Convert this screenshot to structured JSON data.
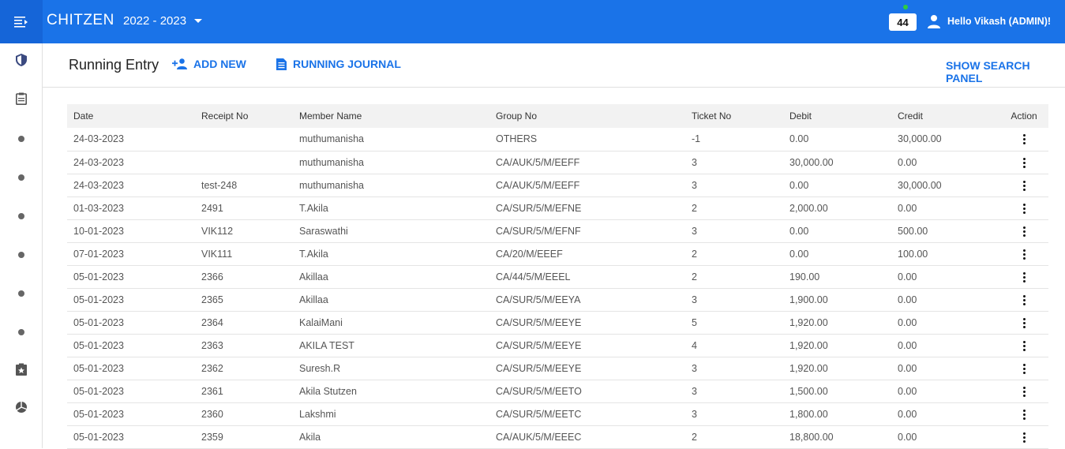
{
  "app": {
    "brand": "CHITZEN",
    "year": "2022 - 2023",
    "notification_count": "44",
    "greeting": "Hello Vikash (ADMIN)!"
  },
  "header": {
    "title": "Running Entry",
    "add_new": "ADD NEW",
    "running_journal": "RUNNING JOURNAL",
    "show_search": "SHOW SEARCH PANEL"
  },
  "columns": [
    "Date",
    "Receipt No",
    "Member Name",
    "Group No",
    "Ticket No",
    "Debit",
    "Credit",
    "Action"
  ],
  "rows": [
    [
      "24-03-2023",
      "",
      "muthumanisha",
      "OTHERS",
      "-1",
      "0.00",
      "30,000.00"
    ],
    [
      "24-03-2023",
      "",
      "muthumanisha",
      "CA/AUK/5/M/EEFF",
      "3",
      "30,000.00",
      "0.00"
    ],
    [
      "24-03-2023",
      "test-248",
      "muthumanisha",
      "CA/AUK/5/M/EEFF",
      "3",
      "0.00",
      "30,000.00"
    ],
    [
      "01-03-2023",
      "2491",
      "T.Akila",
      "CA/SUR/5/M/EFNE",
      "2",
      "2,000.00",
      "0.00"
    ],
    [
      "10-01-2023",
      "VIK112",
      "Saraswathi",
      "CA/SUR/5/M/EFNF",
      "3",
      "0.00",
      "500.00"
    ],
    [
      "07-01-2023",
      "VIK111",
      "T.Akila",
      "CA/20/M/EEEF",
      "2",
      "0.00",
      "100.00"
    ],
    [
      "05-01-2023",
      "2366",
      "Akillaa",
      "CA/44/5/M/EEEL",
      "2",
      "190.00",
      "0.00"
    ],
    [
      "05-01-2023",
      "2365",
      "Akillaa",
      "CA/SUR/5/M/EEYA",
      "3",
      "1,900.00",
      "0.00"
    ],
    [
      "05-01-2023",
      "2364",
      "KalaiMani",
      "CA/SUR/5/M/EEYE",
      "5",
      "1,920.00",
      "0.00"
    ],
    [
      "05-01-2023",
      "2363",
      "AKILA TEST",
      "CA/SUR/5/M/EEYE",
      "4",
      "1,920.00",
      "0.00"
    ],
    [
      "05-01-2023",
      "2362",
      "Suresh.R",
      "CA/SUR/5/M/EEYE",
      "3",
      "1,920.00",
      "0.00"
    ],
    [
      "05-01-2023",
      "2361",
      "Akila Stutzen",
      "CA/SUR/5/M/EETO",
      "3",
      "1,500.00",
      "0.00"
    ],
    [
      "05-01-2023",
      "2360",
      "Lakshmi",
      "CA/SUR/5/M/EETC",
      "3",
      "1,800.00",
      "0.00"
    ],
    [
      "05-01-2023",
      "2359",
      "Akila",
      "CA/AUK/5/M/EEEC",
      "2",
      "18,800.00",
      "0.00"
    ]
  ],
  "sidebar_icons": [
    "shield-icon",
    "clipboard-icon",
    "dot-icon",
    "dot-icon",
    "dot-icon",
    "dot-icon",
    "dot-icon",
    "dot-icon",
    "clipboard-star-icon",
    "pie-chart-icon"
  ],
  "colors": {
    "primary": "#1a73e8",
    "header_bg": "#f2f2f2"
  }
}
